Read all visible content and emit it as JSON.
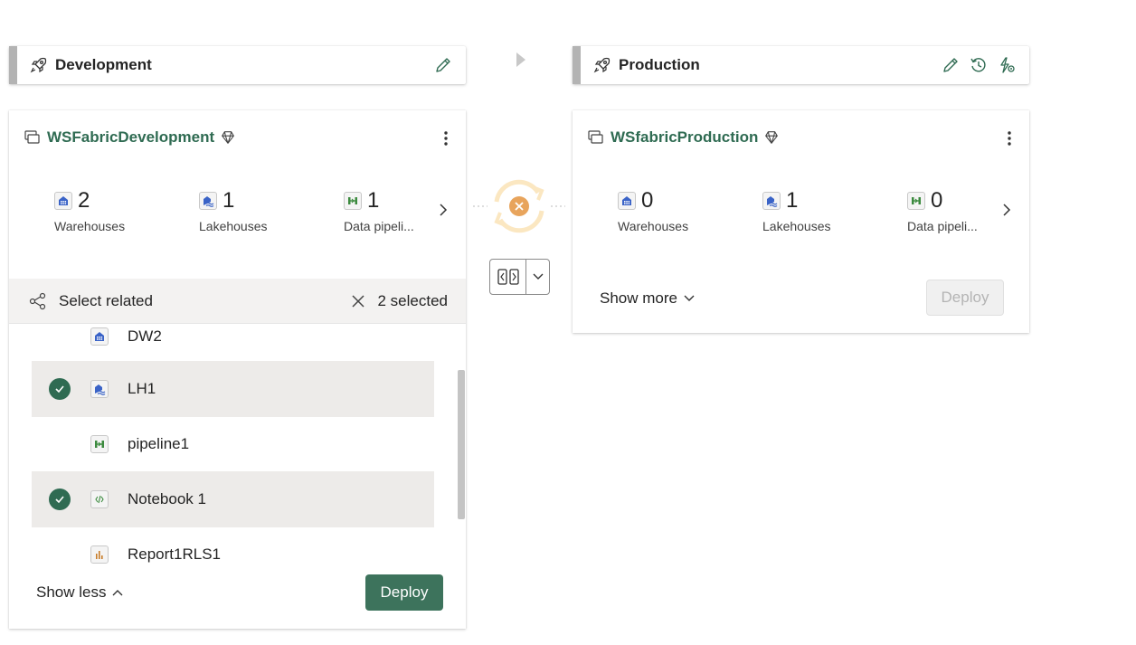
{
  "stages": {
    "dev": {
      "name": "Development"
    },
    "prod": {
      "name": "Production"
    }
  },
  "dev_card": {
    "workspace": "WSFabricDevelopment",
    "stats": [
      {
        "count": "2",
        "label": "Warehouses",
        "icon": "warehouse-icon"
      },
      {
        "count": "1",
        "label": "Lakehouses",
        "icon": "lakehouse-icon"
      },
      {
        "count": "1",
        "label": "Data pipeli...",
        "icon": "pipeline-icon"
      }
    ],
    "select_related": "Select related",
    "selected_count": "2 selected",
    "items": [
      {
        "name": "DW2",
        "icon": "warehouse-icon",
        "selected": false
      },
      {
        "name": "LH1",
        "icon": "lakehouse-icon",
        "selected": true
      },
      {
        "name": "pipeline1",
        "icon": "pipeline-icon",
        "selected": false
      },
      {
        "name": "Notebook 1",
        "icon": "notebook-icon",
        "selected": true
      },
      {
        "name": "Report1RLS1",
        "icon": "report-icon",
        "selected": false
      }
    ],
    "show_less": "Show less",
    "deploy": "Deploy"
  },
  "prod_card": {
    "workspace": "WSfabricProduction",
    "stats": [
      {
        "count": "0",
        "label": "Warehouses",
        "icon": "warehouse-icon"
      },
      {
        "count": "1",
        "label": "Lakehouses",
        "icon": "lakehouse-icon"
      },
      {
        "count": "0",
        "label": "Data pipeli...",
        "icon": "pipeline-icon"
      }
    ],
    "show_more": "Show more",
    "deploy": "Deploy"
  },
  "colors": {
    "accent": "#3d735c",
    "workspace_name": "#2f6b52",
    "sync_status": "#e8a45c"
  }
}
